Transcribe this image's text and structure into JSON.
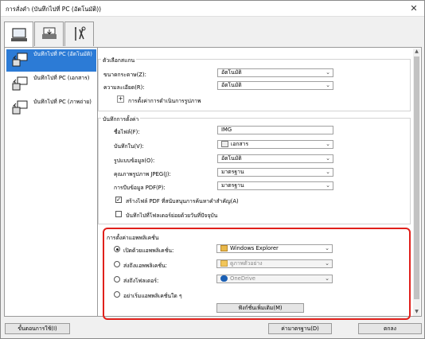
{
  "window": {
    "title": "การสั่งคำ (บันทึกไปที่ PC (อัตโนมัติ))"
  },
  "tabs": [
    {
      "icon": "scan-from-computer-icon"
    },
    {
      "icon": "scan-from-operation-panel-icon"
    },
    {
      "icon": "general-settings-icon"
    }
  ],
  "sidebar": {
    "items": [
      {
        "label": "บันทึกไปที่ PC (อัตโนมัติ)",
        "selected": true,
        "icon": "auto-save-icon"
      },
      {
        "label": "บันทึกไปที่ PC (เอกสาร)",
        "selected": false,
        "icon": "document-save-icon"
      },
      {
        "label": "บันทึกไปที่ PC (ภาพถ่าย)",
        "selected": false,
        "icon": "photo-save-icon"
      }
    ]
  },
  "scan_options": {
    "title": "ตัวเลือกสแกน",
    "paper_size_label": "ขนาดกระดาษ(Z):",
    "paper_size_value": "อัตโนมัติ",
    "resolution_label": "ความละเอียด(R):",
    "resolution_value": "อัตโนมัติ",
    "image_processing_label": "การตั้งค่าการดำเนินการรูปภาพ"
  },
  "save_settings": {
    "title": "บันทึกการตั้งค่า",
    "file_name_label": "ชื่อไฟล์(F):",
    "file_name_value": "IMG",
    "save_in_label": "บันทึกใน(V):",
    "save_in_value": "เอกสาร",
    "data_format_label": "รูปแบบข้อมูล(O):",
    "data_format_value": "อัตโนมัติ",
    "jpeg_quality_label": "คุณภาพรูปภาพ JPEG(J):",
    "jpeg_quality_value": "มาตรฐาน",
    "pdf_compression_label": "การบีบข้อมูล PDF(P):",
    "pdf_compression_value": "มาตรฐาน",
    "keyword_pdf_label": "สร้างไฟล์ PDF ที่สนับสนุนการค้นหาคำสำคัญ(A)",
    "keyword_pdf_checked": true,
    "subfolder_label": "บันทึกไปที่โฟลเดอร์ย่อยด้วยวันที่ปัจจุบัน",
    "subfolder_checked": false
  },
  "app_settings": {
    "title": "การตั้งค่าแอพพลิเคชั่น",
    "open_app_label": "เปิดด้วยแอพพลิเคชั่น:",
    "open_app_value": "Windows Explorer",
    "send_app_label": "ส่งถึงแอพพลิเคชั่น:",
    "send_app_value": "ดูภาพตัวอย่าง",
    "send_folder_label": "ส่งถึงโฟลเดอร์:",
    "send_folder_value": "OneDrive",
    "no_app_label": "อย่าเริ่มแอพพลิเคชั่นใด ๆ",
    "more_functions_label": "ฟังก์ชั่นเพิ่มเติม(M)",
    "selected": "open_app"
  },
  "footer": {
    "instructions_label": "ขั้นตอนการใช้(I)",
    "defaults_label": "ค่ามาตรฐาน(D)",
    "ok_label": "ตกลง"
  },
  "colors": {
    "selection": "#2c7bd6",
    "highlight": "#e0201b"
  }
}
